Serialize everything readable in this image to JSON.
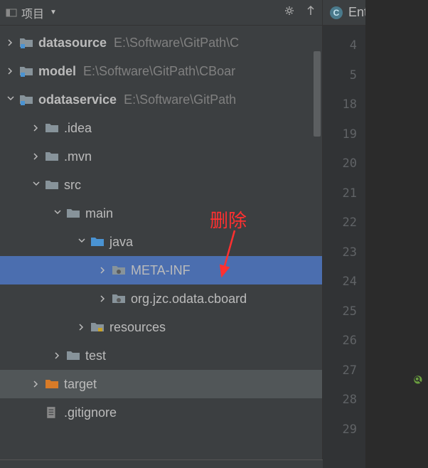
{
  "panel": {
    "title": "项目",
    "dropdown": "▼"
  },
  "tree": {
    "nodes": [
      {
        "indent": 0,
        "expanded": true,
        "icon": "module",
        "label": "datasource",
        "bold": true,
        "path": "E:\\Software\\GitPath\\C"
      },
      {
        "indent": 0,
        "expanded": true,
        "icon": "module",
        "label": "model",
        "bold": true,
        "path": "E:\\Software\\GitPath\\CBoar"
      },
      {
        "indent": 0,
        "expanded": false,
        "icon": "module",
        "label": "odataservice",
        "bold": true,
        "path": "E:\\Software\\GitPath"
      },
      {
        "indent": 1,
        "expanded": true,
        "icon": "folder",
        "label": ".idea",
        "bold": false,
        "path": ""
      },
      {
        "indent": 1,
        "expanded": true,
        "icon": "folder",
        "label": ".mvn",
        "bold": false,
        "path": ""
      },
      {
        "indent": 1,
        "expanded": false,
        "icon": "folder",
        "label": "src",
        "bold": false,
        "path": ""
      },
      {
        "indent": 2,
        "expanded": false,
        "icon": "folder",
        "label": "main",
        "bold": false,
        "path": ""
      },
      {
        "indent": 3,
        "expanded": false,
        "icon": "source-folder",
        "label": "java",
        "bold": false,
        "path": ""
      },
      {
        "indent": 4,
        "expanded": true,
        "icon": "package",
        "label": "META-INF",
        "bold": false,
        "path": "",
        "selected": true
      },
      {
        "indent": 4,
        "expanded": true,
        "icon": "package",
        "label": "org.jzc.odata.cboard",
        "bold": false,
        "path": ""
      },
      {
        "indent": 3,
        "expanded": true,
        "icon": "resources-folder",
        "label": "resources",
        "bold": false,
        "path": ""
      },
      {
        "indent": 2,
        "expanded": true,
        "icon": "folder",
        "label": "test",
        "bold": false,
        "path": ""
      },
      {
        "indent": 1,
        "expanded": true,
        "icon": "target-folder",
        "label": "target",
        "bold": false,
        "path": "",
        "targetRow": true
      },
      {
        "indent": 1,
        "expanded": null,
        "icon": "gitignore",
        "label": ".gitignore",
        "bold": false,
        "path": ""
      }
    ]
  },
  "annotation": {
    "text": "删除"
  },
  "editor": {
    "tab_icon_letter": "C",
    "tab_label": "EntityS",
    "line_numbers": [
      "4",
      "5",
      "18",
      "19",
      "20",
      "21",
      "22",
      "23",
      "24",
      "25",
      "26",
      "27",
      "28",
      "29"
    ]
  }
}
